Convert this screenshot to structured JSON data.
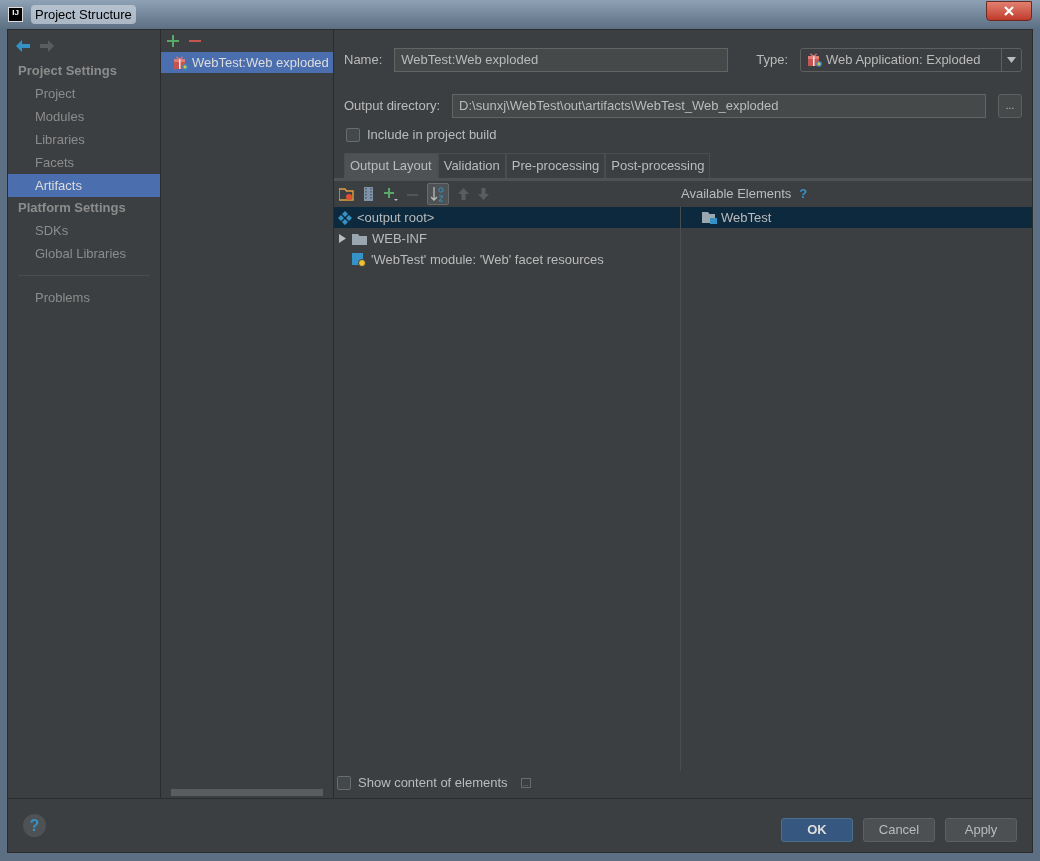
{
  "window": {
    "title": "Project Structure",
    "app_badge": "IJ"
  },
  "nav": {
    "sections": [
      {
        "heading": "Project Settings",
        "items": [
          {
            "label": "Project",
            "selected": false
          },
          {
            "label": "Modules",
            "selected": false
          },
          {
            "label": "Libraries",
            "selected": false
          },
          {
            "label": "Facets",
            "selected": false
          },
          {
            "label": "Artifacts",
            "selected": true
          }
        ]
      },
      {
        "heading": "Platform Settings",
        "items": [
          {
            "label": "SDKs",
            "selected": false
          },
          {
            "label": "Global Libraries",
            "selected": false
          }
        ]
      }
    ],
    "extra_items": [
      {
        "label": "Problems",
        "selected": false
      }
    ]
  },
  "artifacts": {
    "items": [
      {
        "label": "WebTest:Web exploded",
        "selected": true
      }
    ]
  },
  "form": {
    "name_label": "Name:",
    "name_value": "WebTest:Web exploded",
    "type_label": "Type:",
    "type_value": "Web Application: Exploded",
    "output_label": "Output directory:",
    "output_value": "D:\\sunxj\\WebTest\\out\\artifacts\\WebTest_Web_exploded",
    "browse": "...",
    "include": {
      "label": "Include in project build",
      "checked": false
    }
  },
  "tabs": [
    {
      "label": "Output Layout",
      "selected": true
    },
    {
      "label": "Validation",
      "selected": false
    },
    {
      "label": "Pre-processing",
      "selected": false
    },
    {
      "label": "Post-processing",
      "selected": false
    }
  ],
  "layout": {
    "available_label": "Available Elements",
    "available_help": "?",
    "tree": [
      {
        "label": "<output root>",
        "kind": "root",
        "selected": true
      },
      {
        "label": "WEB-INF",
        "kind": "folder",
        "expanded": false,
        "selected": false
      },
      {
        "label": "'WebTest' module: 'Web' facet resources",
        "kind": "facet",
        "selected": false
      }
    ],
    "available": [
      {
        "label": "WebTest",
        "selected": true
      }
    ],
    "show_content": {
      "label": "Show content of elements",
      "checked": false
    },
    "show_content_more": "..."
  },
  "footer": {
    "help": "?",
    "buttons": [
      {
        "label": "OK",
        "default": true
      },
      {
        "label": "Cancel",
        "default": false
      },
      {
        "label": "Apply",
        "default": false
      }
    ]
  }
}
